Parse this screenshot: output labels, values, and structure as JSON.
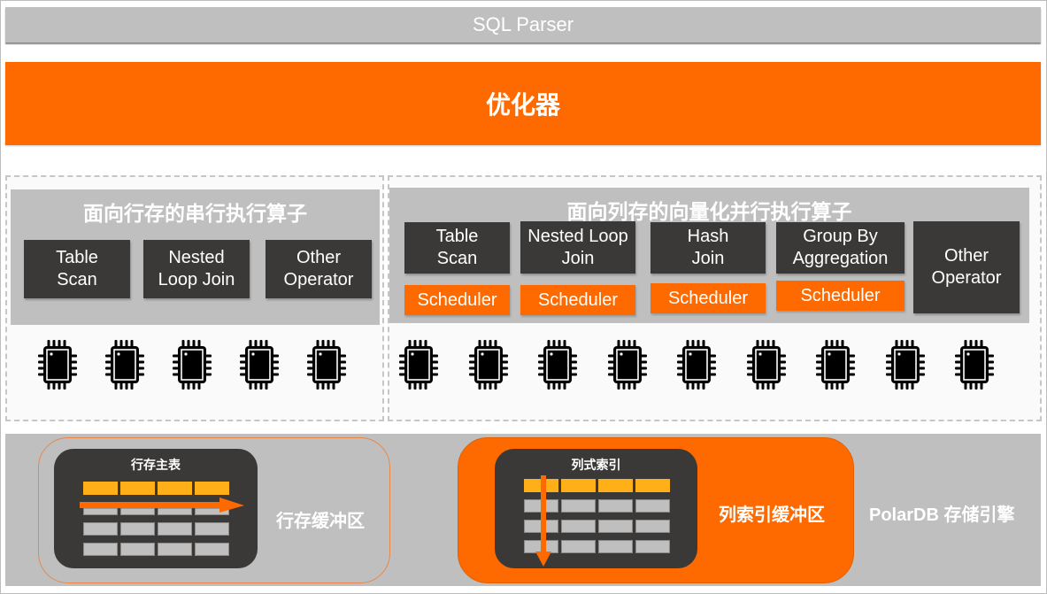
{
  "layers": {
    "parser": "SQL Parser",
    "optimizer": "优化器"
  },
  "row_engine": {
    "title": "面向行存的串行执行算子",
    "operators": [
      {
        "label": "Table\nScan"
      },
      {
        "label": "Nested\nLoop Join"
      },
      {
        "label": "Other\nOperator"
      }
    ],
    "cpu_count": 5,
    "cpu_icon": "cpu-chip-icon"
  },
  "col_engine": {
    "title": "面向列存的向量化并行执行算子",
    "operators": [
      {
        "label": "Table\nScan",
        "scheduler": "Scheduler"
      },
      {
        "label": "Nested Loop\nJoin",
        "scheduler": "Scheduler"
      },
      {
        "label": "Hash\nJoin",
        "scheduler": "Scheduler"
      },
      {
        "label": "Group By\nAggregation",
        "scheduler": "Scheduler"
      },
      {
        "label": "Other\nOperator"
      }
    ],
    "cpu_count": 9,
    "cpu_icon": "cpu-chip-icon"
  },
  "storage": {
    "row_buffer": {
      "table_title": "行存主表",
      "label": "行存缓冲区",
      "scan_direction": "horizontal"
    },
    "col_buffer": {
      "table_title": "列式索引",
      "label": "列索引缓冲区",
      "scan_direction": "vertical"
    },
    "engine_label": "PolarDB 存储引擎",
    "table_rows": 4,
    "table_cols": 4
  },
  "colors": {
    "accent_orange": "#ff6a00",
    "header_yellow": "#ffb019",
    "dark_box": "#3a3938",
    "grey": "#bfbfbf"
  }
}
